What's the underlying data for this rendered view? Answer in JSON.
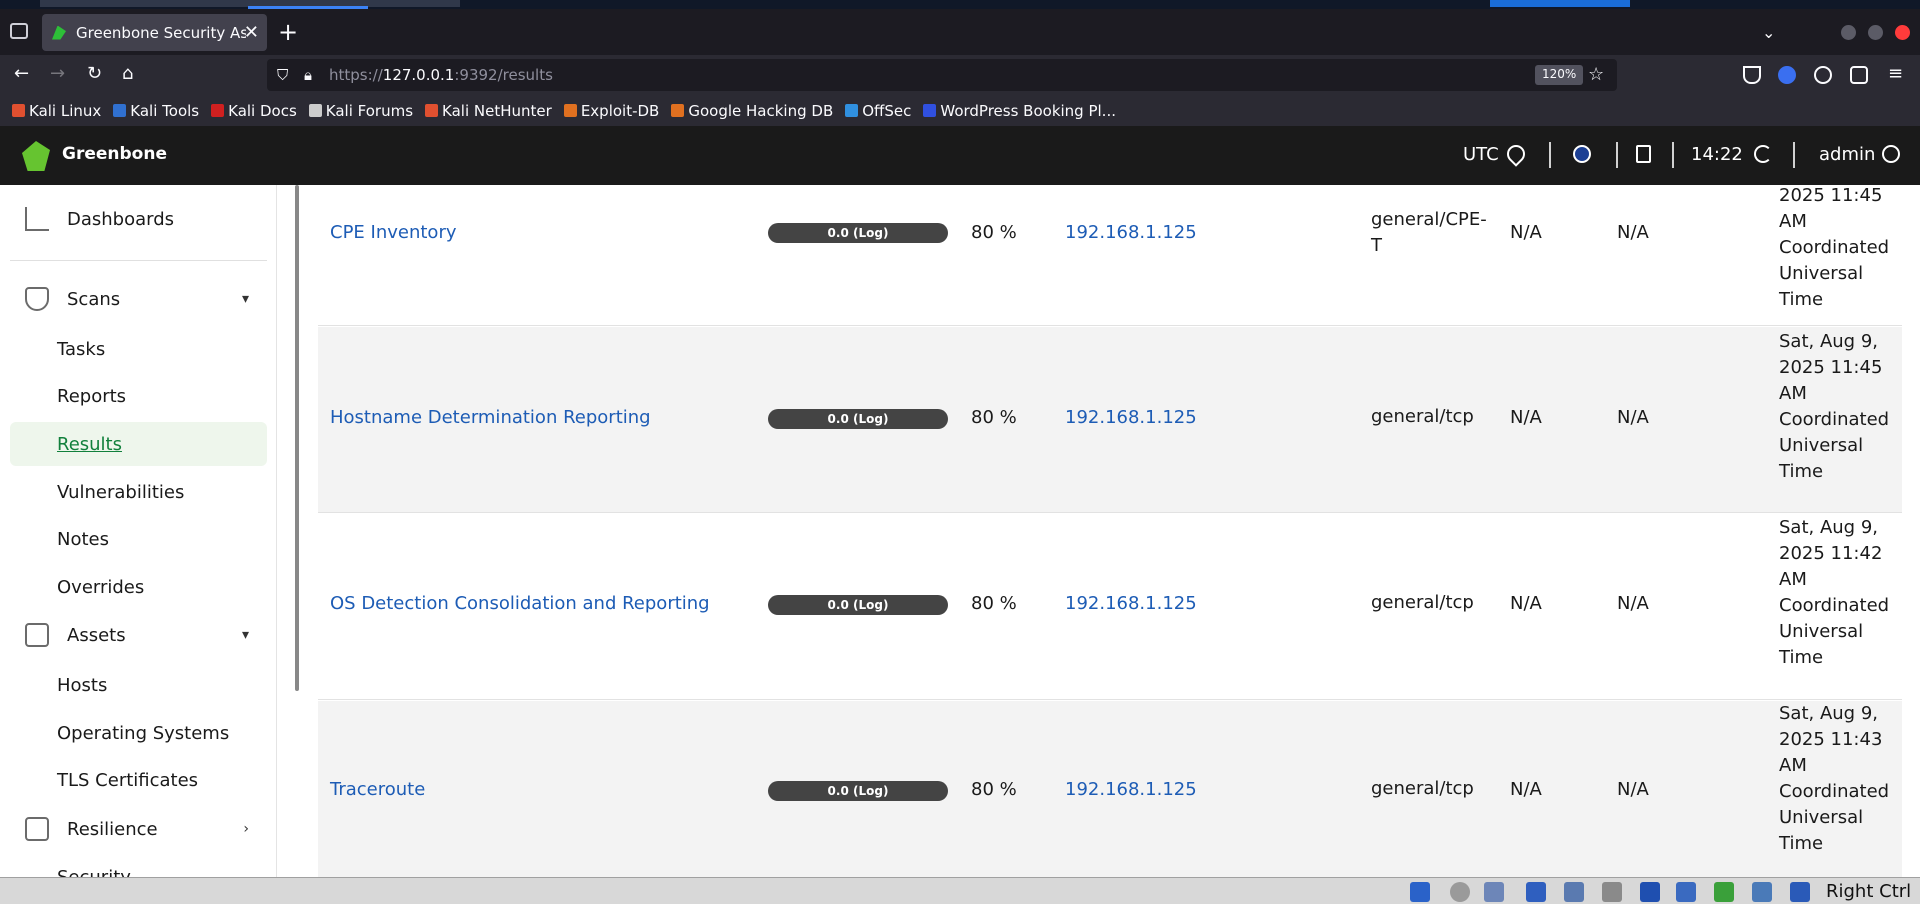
{
  "browser": {
    "tab": {
      "title": "Greenbone Security Assistant"
    },
    "url": {
      "prefix": "https://",
      "host": "127.0.0.1",
      "rest": ":9392/results"
    },
    "zoom": "120%",
    "bookmarks": [
      {
        "label": "Kali Linux",
        "icon_color": "#e05030"
      },
      {
        "label": "Kali Tools",
        "icon_color": "#3070d0"
      },
      {
        "label": "Kali Docs",
        "icon_color": "#d02020"
      },
      {
        "label": "Kali Forums",
        "icon_color": "#cccccc"
      },
      {
        "label": "Kali NetHunter",
        "icon_color": "#e05030"
      },
      {
        "label": "Exploit-DB",
        "icon_color": "#e07020"
      },
      {
        "label": "Google Hacking DB",
        "icon_color": "#e07020"
      },
      {
        "label": "OffSec",
        "icon_color": "#3090e0"
      },
      {
        "label": "WordPress Booking Pl...",
        "icon_color": "#3050e0"
      }
    ]
  },
  "header": {
    "brand": "Greenbone",
    "timezone": "UTC",
    "time": "14:22",
    "user": "admin"
  },
  "sidebar": {
    "dashboards": "Dashboards",
    "scans": "Scans",
    "scan_items": [
      "Tasks",
      "Reports",
      "Results",
      "Vulnerabilities",
      "Notes",
      "Overrides"
    ],
    "assets": "Assets",
    "asset_items": [
      "Hosts",
      "Operating Systems",
      "TLS Certificates"
    ],
    "resilience": "Resilience",
    "cut_item": "Security"
  },
  "results": [
    {
      "vulnerability": "CPE Inventory",
      "severity": "0.0 (Log)",
      "qod": "80 %",
      "host": "192.168.1.125",
      "location": "general/CPE-T",
      "na1": "N/A",
      "na2": "N/A",
      "created": "2025 11:45 AM Coordinated Universal Time"
    },
    {
      "vulnerability": "Hostname Determination Reporting",
      "severity": "0.0 (Log)",
      "qod": "80 %",
      "host": "192.168.1.125",
      "location": "general/tcp",
      "na1": "N/A",
      "na2": "N/A",
      "created": "Sat, Aug 9, 2025 11:45 AM Coordinated Universal Time"
    },
    {
      "vulnerability": "OS Detection Consolidation and Reporting",
      "severity": "0.0 (Log)",
      "qod": "80 %",
      "host": "192.168.1.125",
      "location": "general/tcp",
      "na1": "N/A",
      "na2": "N/A",
      "created": "Sat, Aug 9, 2025 11:42 AM Coordinated Universal Time"
    },
    {
      "vulnerability": "Traceroute",
      "severity": "0.0 (Log)",
      "qod": "80 %",
      "host": "192.168.1.125",
      "location": "general/tcp",
      "na1": "N/A",
      "na2": "N/A",
      "created": "Sat, Aug 9, 2025 11:43 AM Coordinated Universal Time"
    }
  ],
  "taskbar": {
    "right_label": "Right Ctrl"
  }
}
